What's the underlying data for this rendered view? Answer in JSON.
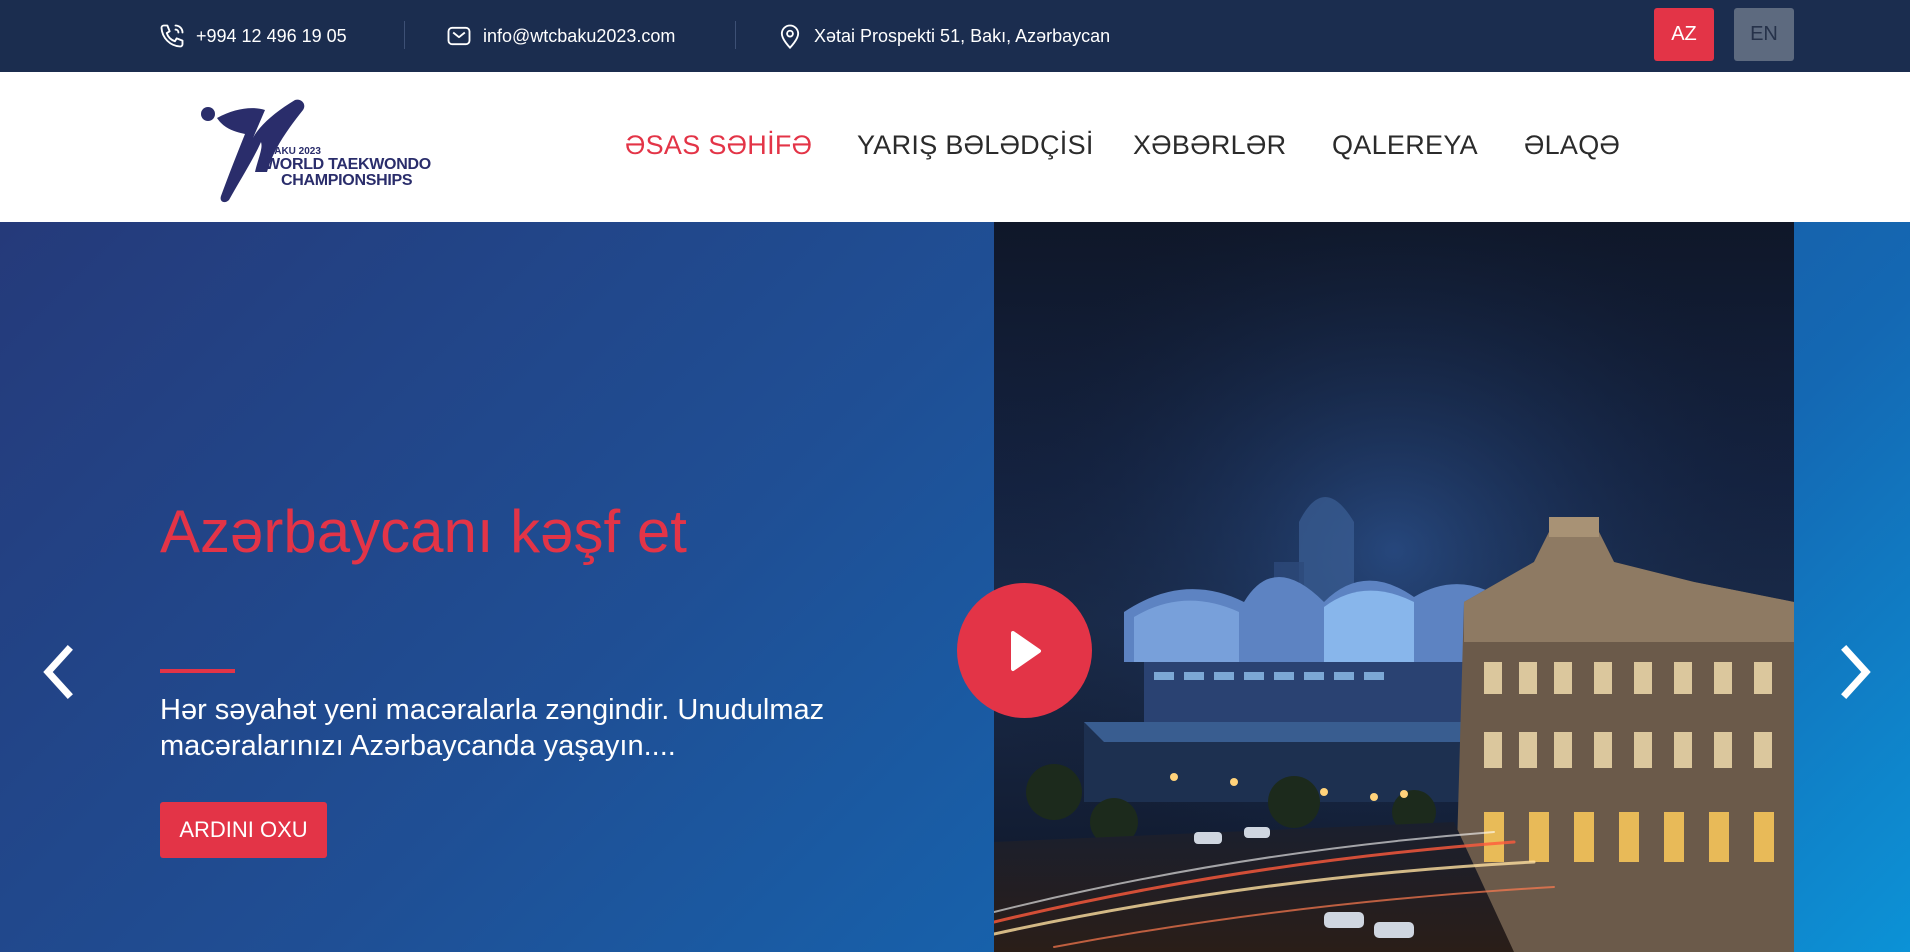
{
  "topbar": {
    "phone": "+994 12 496 19 05",
    "email": "info@wtcbaku2023.com",
    "address": "Xətai Prospekti 51, Bakı, Azərbaycan",
    "languages": [
      {
        "code": "AZ",
        "active": true
      },
      {
        "code": "EN",
        "active": false
      }
    ],
    "colors": {
      "background": "#1b2d4f",
      "accent": "#e33447"
    }
  },
  "logo": {
    "line1": "BAKU 2023",
    "line2": "WORLD TAEKWONDO",
    "line3": "CHAMPIONSHIPS"
  },
  "nav": {
    "items": [
      {
        "label": "ƏSAS SƏHİFƏ",
        "active": true
      },
      {
        "label": "YARIŞ BƏLƏDÇİSİ",
        "active": false
      },
      {
        "label": "XƏBƏRLƏR",
        "active": false
      },
      {
        "label": "QALEREYA",
        "active": false
      },
      {
        "label": "ƏLAQƏ",
        "active": false
      }
    ]
  },
  "hero": {
    "title": "Azərbaycanı kəşf et",
    "description": "Hər səyahət yeni macəralarla zəngindir. Unudulmaz macəralarınızı Azərbaycanda yaşayın....",
    "button_label": "ARDINI OXU",
    "prev_icon": "chevron-left-icon",
    "next_icon": "chevron-right-icon",
    "play_icon": "play-icon"
  }
}
